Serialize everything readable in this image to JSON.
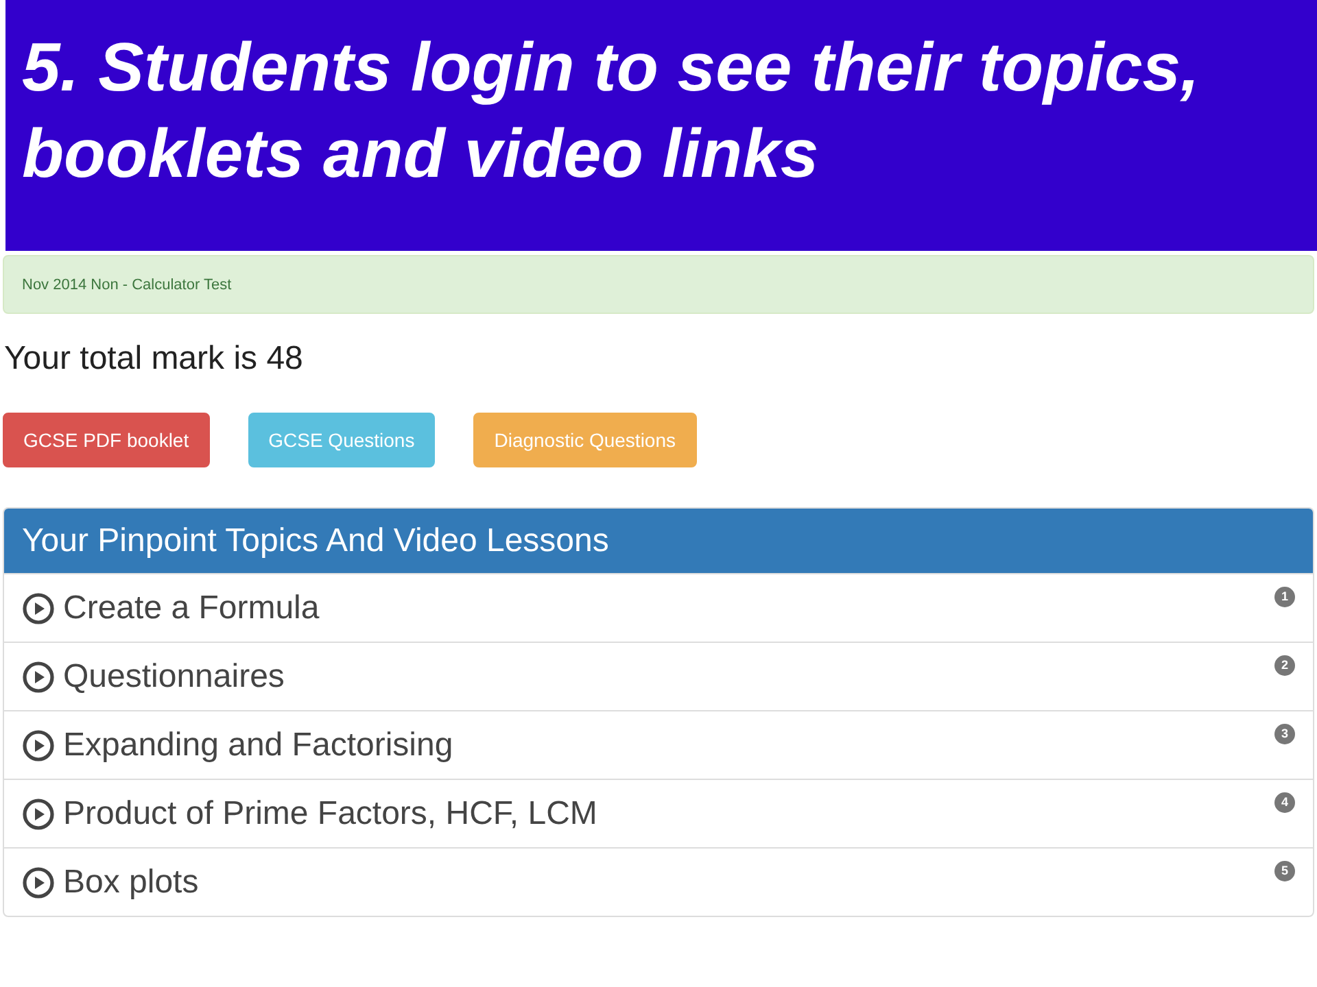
{
  "slide_title": "5. Students login to see their topics, booklets and video links",
  "alert": "Nov 2014 Non - Calculator Test",
  "total_mark": "Your total mark is 48",
  "buttons": [
    {
      "label": "GCSE PDF booklet",
      "kind": "danger"
    },
    {
      "label": "GCSE Questions",
      "kind": "info"
    },
    {
      "label": "Diagnostic Questions",
      "kind": "warning"
    }
  ],
  "panel": {
    "heading": "Your Pinpoint Topics And Video Lessons",
    "items": [
      {
        "label": "Create a Formula",
        "badge": "1"
      },
      {
        "label": "Questionnaires",
        "badge": "2"
      },
      {
        "label": "Expanding and Factorising",
        "badge": "3"
      },
      {
        "label": "Product of Prime Factors, HCF, LCM",
        "badge": "4"
      },
      {
        "label": "Box plots",
        "badge": "5"
      }
    ]
  }
}
